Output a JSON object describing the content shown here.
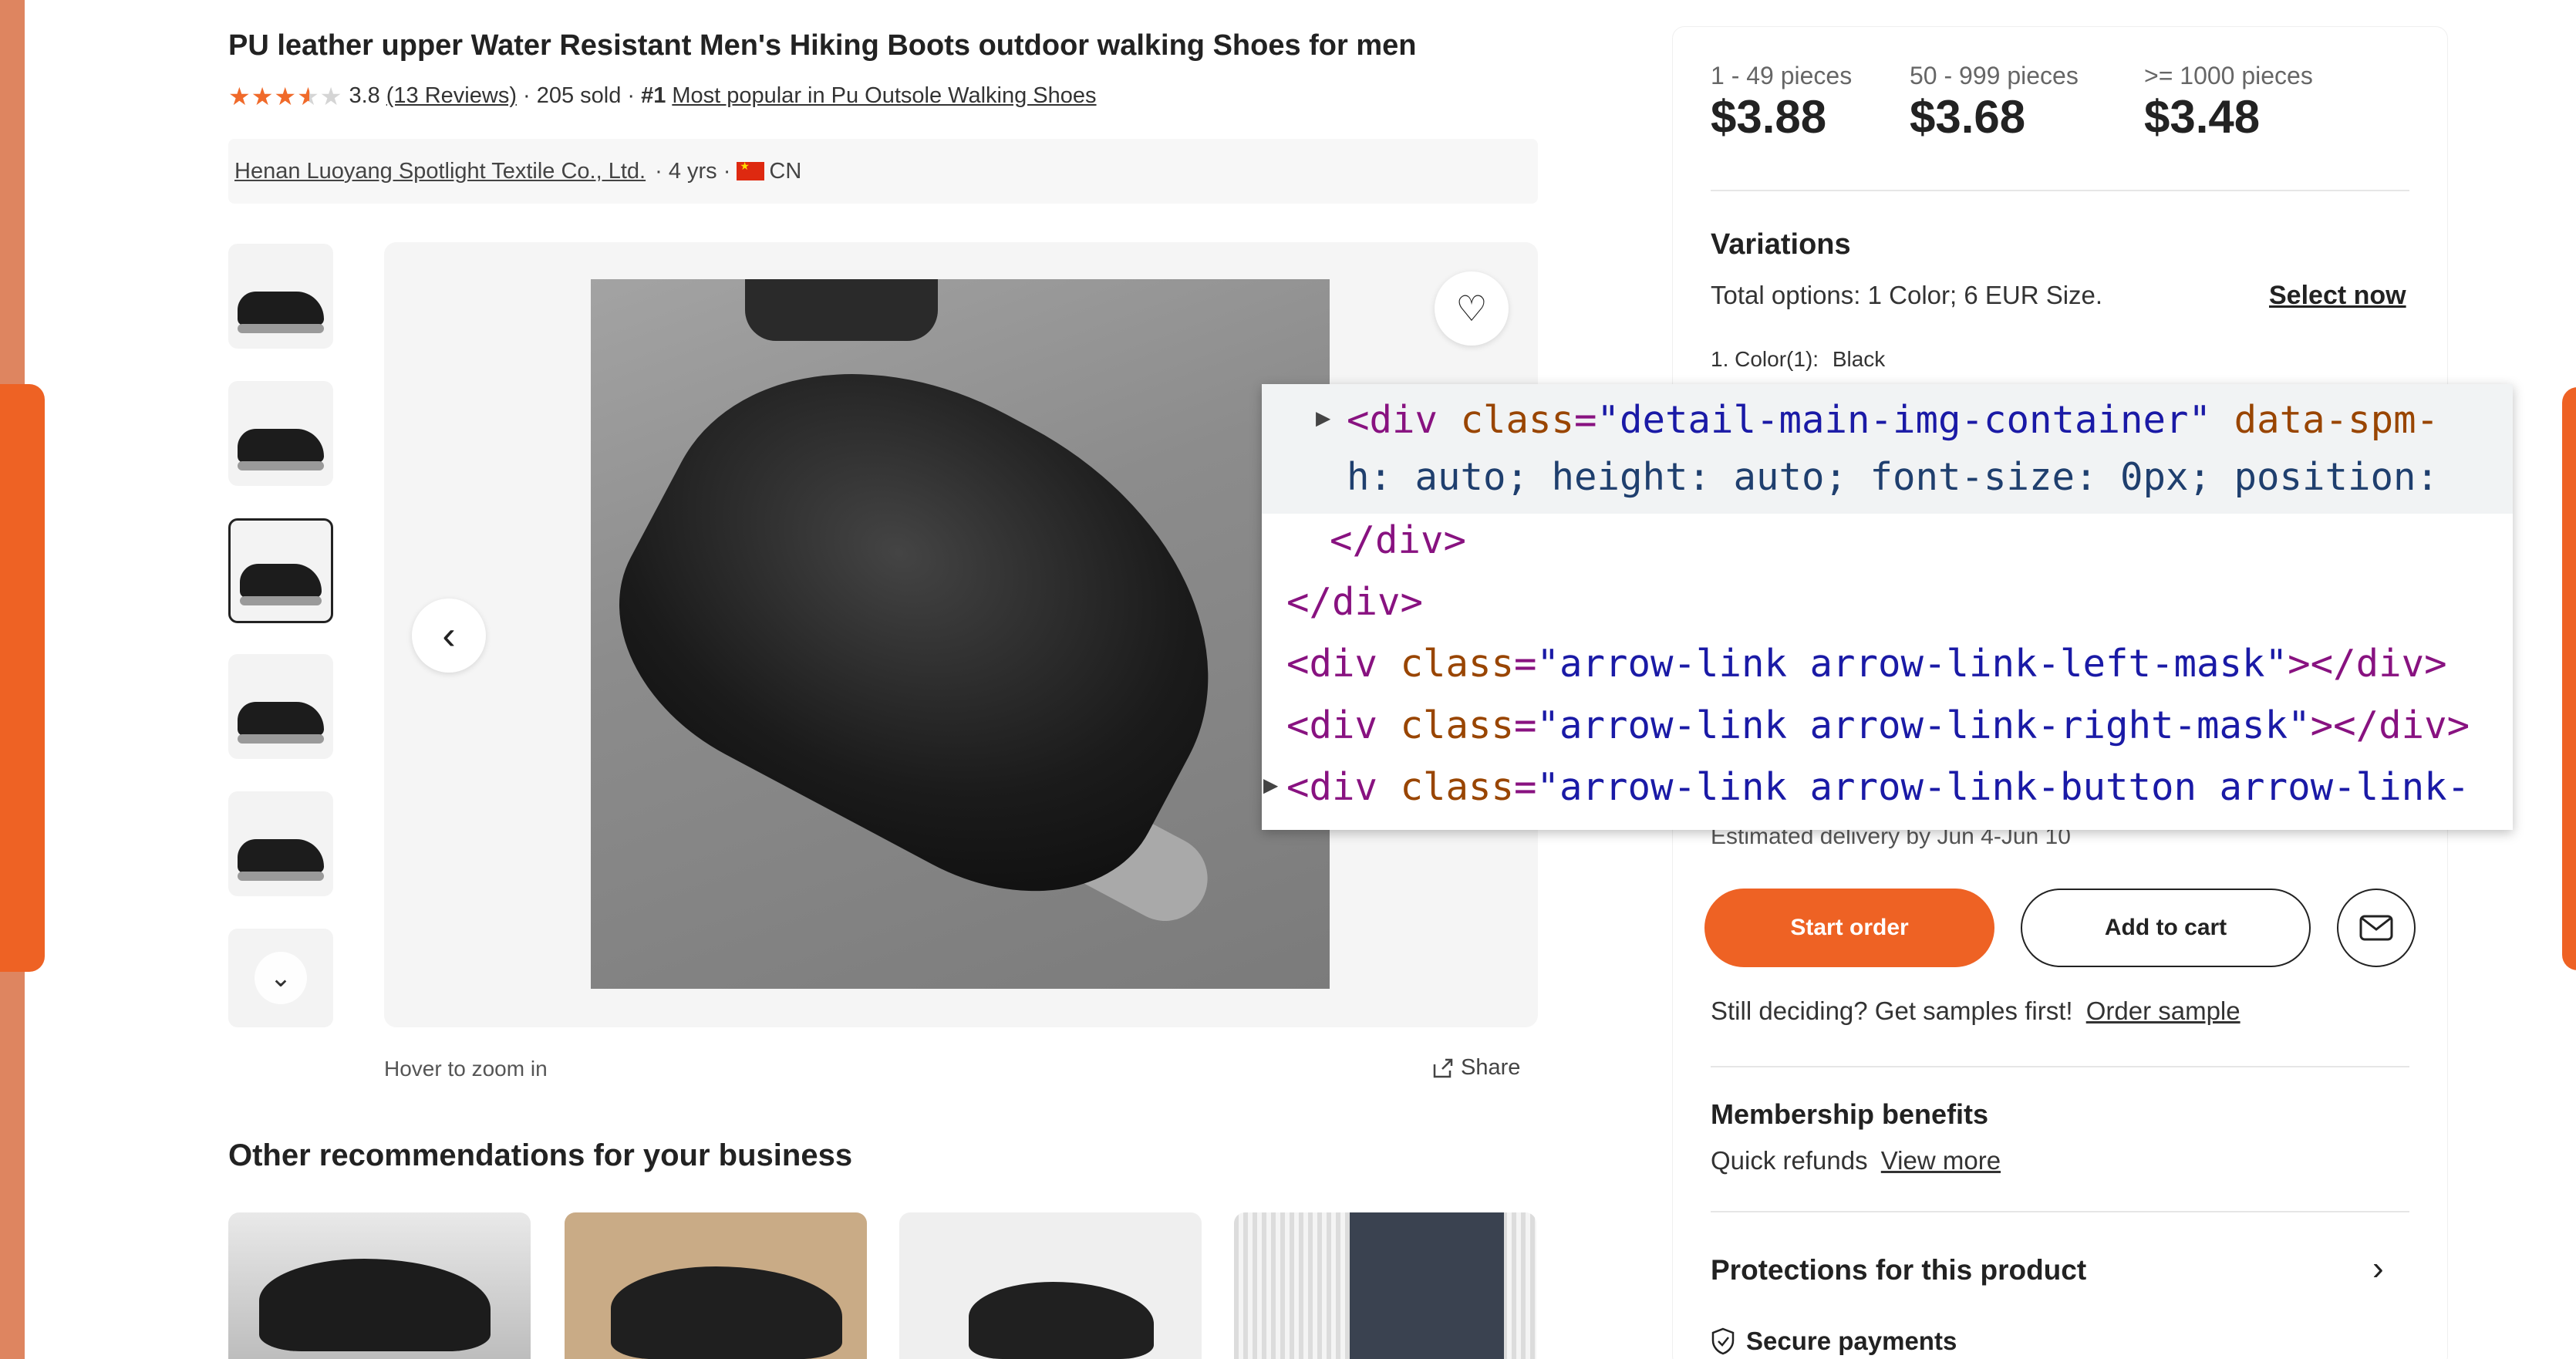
{
  "product": {
    "title": "PU leather upper Water Resistant Men's Hiking Boots outdoor walking Shoes for men",
    "rating": 3.8,
    "rating_text": "3.8",
    "reviews_link": "(13 Reviews)",
    "sold": "· 205 sold ·",
    "rank_badge": "#1",
    "rank_link": "Most popular in Pu Outsole Walking Shoes"
  },
  "supplier": {
    "name": "Henan Luoyang Spotlight Textile Co., Ltd.",
    "years": "· 4 yrs ·",
    "country": "CN"
  },
  "gallery": {
    "thumbnail_count": 6,
    "active_index": 2,
    "hover_hint": "Hover to zoom in",
    "share_label": "Share"
  },
  "recommendations": {
    "heading": "Other recommendations for your business"
  },
  "pricing": {
    "tiers": [
      {
        "label": "1 - 49 pieces",
        "price": "$3.88"
      },
      {
        "label": "50 - 999 pieces",
        "price": "$3.68"
      },
      {
        "label": ">= 1000 pieces",
        "price": "$3.48"
      }
    ]
  },
  "variations": {
    "title": "Variations",
    "options": "Total options: 1 Color; 6 EUR Size.",
    "select_now": "Select now",
    "color_label": "1. Color(1):",
    "color_value": "Black"
  },
  "order": {
    "delivery": "Estimated delivery by Jun 4-Jun 10",
    "start_order": "Start order",
    "add_to_cart": "Add to cart",
    "samples_text": "Still deciding? Get samples first!",
    "order_sample": "Order sample"
  },
  "membership": {
    "title": "Membership benefits",
    "text": "Quick refunds",
    "link": "View more"
  },
  "protections": {
    "title": "Protections for this product",
    "secure_payments": "Secure payments"
  },
  "devtools": {
    "line1_class": "\"detail-main-img-container\"",
    "line1_rest": " data-spm-",
    "line2": "h: auto; height: auto; font-size: 0px; position:",
    "line3": "</div>",
    "line4": "</div>",
    "line5_class": "\"arrow-link arrow-link-left-mask\"",
    "line6_class": "\"arrow-link arrow-link-right-mask\"",
    "line7_class": "\"arrow-link arrow-link-button arrow-link-"
  },
  "colors": {
    "accent": "#ee6224",
    "edge": "#de8560",
    "star": "#f06a2a"
  }
}
